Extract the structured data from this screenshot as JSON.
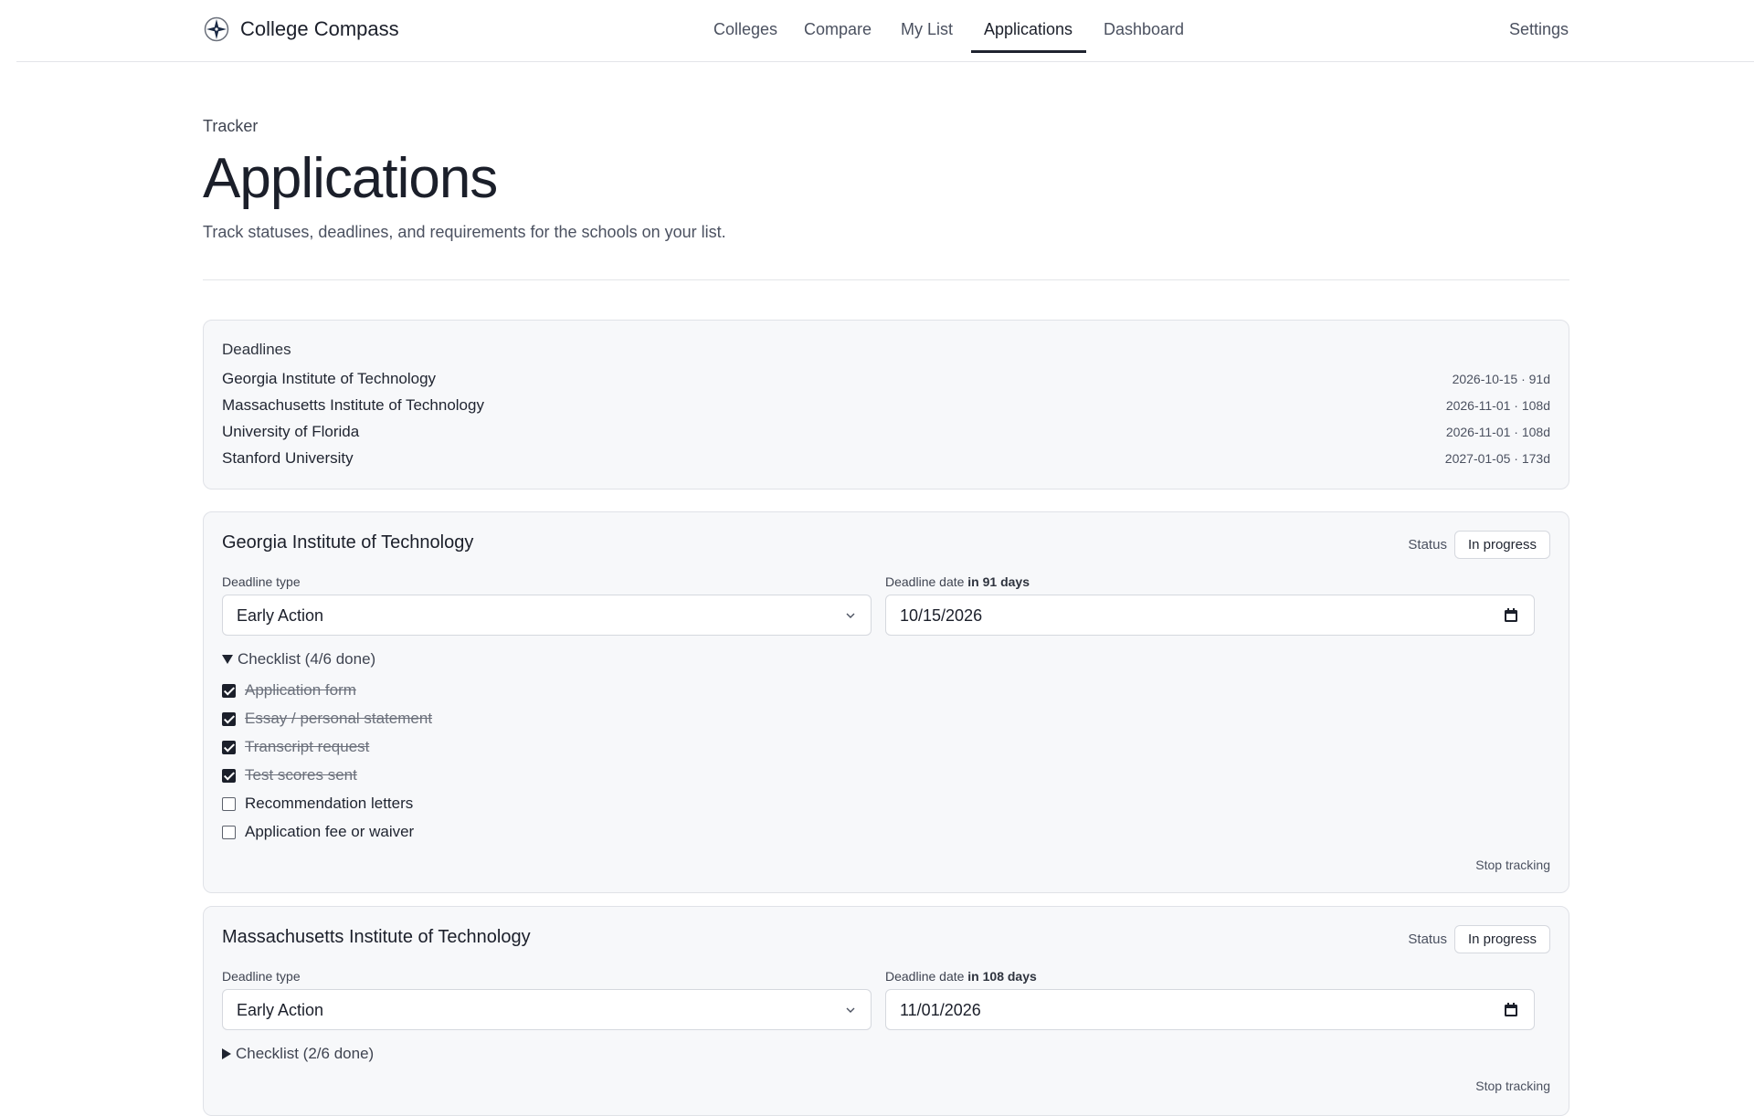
{
  "brand": {
    "name": "College Compass",
    "icon": "compass-icon"
  },
  "nav": {
    "items": [
      "Colleges",
      "Compare",
      "My List",
      "Applications",
      "Dashboard"
    ],
    "active": "Applications",
    "settings": "Settings"
  },
  "page": {
    "eyebrow": "Tracker",
    "title": "Applications",
    "subtitle": "Track statuses, deadlines, and requirements for the schools on your list."
  },
  "deadlines": {
    "title": "Deadlines",
    "rows": [
      {
        "name": "Georgia Institute of Technology",
        "meta": "2026-10-15 · 91d"
      },
      {
        "name": "Massachusetts Institute of Technology",
        "meta": "2026-11-01 · 108d"
      },
      {
        "name": "University of Florida",
        "meta": "2026-11-01 · 108d"
      },
      {
        "name": "Stanford University",
        "meta": "2027-01-05 · 173d"
      }
    ]
  },
  "applications": [
    {
      "name": "Georgia Institute of Technology",
      "status_label": "Status",
      "status": "In progress",
      "deadline_type_label": "Deadline type",
      "deadline_type": "Early Action",
      "deadline_date_label": "Deadline date",
      "deadline_in": "in 91 days",
      "deadline_date": "10/15/2026",
      "checklist_summary": "Checklist (4/6 done)",
      "checklist_open": true,
      "checklist": [
        {
          "label": "Application form",
          "done": true
        },
        {
          "label": "Essay / personal statement",
          "done": true
        },
        {
          "label": "Transcript request",
          "done": true
        },
        {
          "label": "Test scores sent",
          "done": true
        },
        {
          "label": "Recommendation letters",
          "done": false
        },
        {
          "label": "Application fee or waiver",
          "done": false
        }
      ],
      "stop_label": "Stop tracking"
    },
    {
      "name": "Massachusetts Institute of Technology",
      "status_label": "Status",
      "status": "In progress",
      "deadline_type_label": "Deadline type",
      "deadline_type": "Early Action",
      "deadline_date_label": "Deadline date",
      "deadline_in": "in 108 days",
      "deadline_date": "11/01/2026",
      "checklist_summary": "Checklist (2/6 done)",
      "checklist_open": false,
      "stop_label": "Stop tracking"
    }
  ]
}
